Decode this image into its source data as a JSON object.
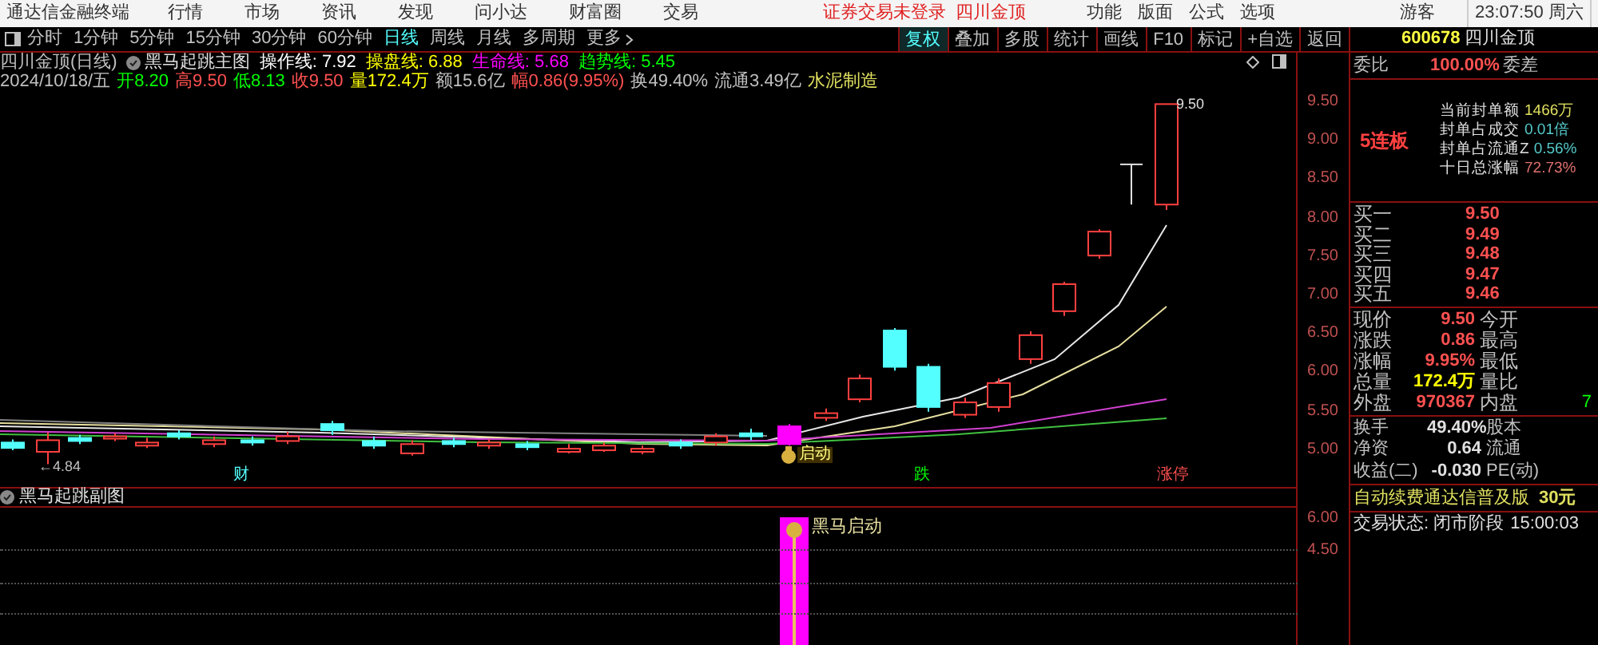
{
  "title_bar": {
    "app_name": "通达信金融终端",
    "menu": [
      "行情",
      "市场",
      "资讯",
      "发现",
      "问小达",
      "财富圈",
      "交易"
    ],
    "login_status": "证券交易未登录",
    "stock": "四川金顶",
    "tools": [
      "功能",
      "版面",
      "公式",
      "选项"
    ],
    "user": "游客",
    "clock": "23:07:50 周六"
  },
  "periods": [
    {
      "label": "分时",
      "selected": false
    },
    {
      "label": "1分钟",
      "selected": false
    },
    {
      "label": "5分钟",
      "selected": false
    },
    {
      "label": "15分钟",
      "selected": false
    },
    {
      "label": "30分钟",
      "selected": false
    },
    {
      "label": "60分钟",
      "selected": false
    },
    {
      "label": "日线",
      "selected": true
    },
    {
      "label": "周线",
      "selected": false
    },
    {
      "label": "月线",
      "selected": false
    },
    {
      "label": "多周期",
      "selected": false
    }
  ],
  "more": "更多",
  "toolbar": [
    {
      "label": "复权",
      "selected": true
    },
    {
      "label": "叠加",
      "selected": false
    },
    {
      "label": "多股",
      "selected": false
    },
    {
      "label": "统计",
      "selected": false
    },
    {
      "label": "画线",
      "selected": false
    },
    {
      "label": "F10",
      "selected": false
    },
    {
      "label": "标记",
      "selected": false
    },
    {
      "label": "+自选",
      "selected": false
    },
    {
      "label": "返回",
      "selected": false
    }
  ],
  "quote_header": {
    "code": "600678",
    "name": "四川金顶"
  },
  "indicator": {
    "title": "四川金顶(日线)",
    "name": "黑马起跳主图",
    "lines": [
      {
        "label": "操作线:",
        "value": "7.92",
        "color": "#ffffff"
      },
      {
        "label": "操盘线:",
        "value": "6.88",
        "color": "#ffff00"
      },
      {
        "label": "生命线:",
        "value": "5.68",
        "color": "#ff00ff"
      },
      {
        "label": "趋势线:",
        "value": "5.45",
        "color": "#00ff00"
      }
    ]
  },
  "day_stats": [
    {
      "text": "2024/10/18/五",
      "color": "#c0c0c0"
    },
    {
      "text": "开8.20",
      "color": "#00ff00"
    },
    {
      "text": "高9.50",
      "color": "#ff5050"
    },
    {
      "text": "低8.13",
      "color": "#00ff00"
    },
    {
      "text": "收9.50",
      "color": "#ff5050"
    },
    {
      "text": "量172.4万",
      "color": "#ffff00"
    },
    {
      "text": "额15.6亿",
      "color": "#c0c0c0"
    },
    {
      "text": "幅0.86(9.95%)",
      "color": "#ff5050"
    },
    {
      "text": "换49.40%",
      "color": "#c0c0c0"
    },
    {
      "text": "流通3.49亿",
      "color": "#c0c0c0"
    },
    {
      "text": "水泥制造",
      "color": "#e0e060"
    }
  ],
  "chart": {
    "price_ticks": [
      "9.50",
      "9.00",
      "8.50",
      "8.00",
      "7.50",
      "7.00",
      "6.50",
      "6.00",
      "5.50",
      "5.00"
    ],
    "high_label": "9.50",
    "low_label": "←4.84",
    "launch_tag": "启动",
    "signals": [
      {
        "text": "财",
        "color": "#54ffff"
      },
      {
        "text": "跌",
        "color": "#00ff00"
      },
      {
        "text": "涨停",
        "color": "#ff5050"
      }
    ]
  },
  "sub_chart": {
    "title": "黑马起跳副图",
    "ticks": [
      "6.00",
      "4.50"
    ],
    "signal": "黑马启动"
  },
  "quote_panel": {
    "ratio": {
      "label": "委比",
      "value": "100.00%",
      "label2": "委差"
    },
    "streak": "5连板",
    "seal_stats": [
      {
        "label": "当前封单额",
        "value": "1466万",
        "color": "#e0e060"
      },
      {
        "label": "封单占成交",
        "value": "0.01倍",
        "color": "#54c8c8"
      },
      {
        "label": "封单占流通Z",
        "value": "0.56%",
        "color": "#54c8c8"
      },
      {
        "label": "十日总涨幅",
        "value": "72.73%",
        "color": "#e07070"
      }
    ],
    "bids": [
      {
        "label": "买一",
        "price": "9.50"
      },
      {
        "label": "买二",
        "price": "9.49"
      },
      {
        "label": "买三",
        "price": "9.48"
      },
      {
        "label": "买四",
        "price": "9.47"
      },
      {
        "label": "买五",
        "price": "9.46"
      }
    ],
    "quotes": [
      {
        "label": "现价",
        "value": "9.50",
        "color": "#ff5050",
        "label2": "今开"
      },
      {
        "label": "涨跌",
        "value": "0.86",
        "color": "#ff5050",
        "label2": "最高"
      },
      {
        "label": "涨幅",
        "value": "9.95%",
        "color": "#ff5050",
        "label2": "最低"
      },
      {
        "label": "总量",
        "value": "172.4万",
        "color": "#ffff00",
        "label2": "量比"
      },
      {
        "label": "外盘",
        "value": "970367",
        "color": "#ff5050",
        "label2": "内盘",
        "value2": {
          "text": "7",
          "color": "#00ff00"
        }
      }
    ],
    "fundamentals": [
      {
        "label": "换手",
        "value": "49.40%",
        "label2": "股本"
      },
      {
        "label": "净资",
        "value": "0.64",
        "label2": "流通"
      },
      {
        "label": "收益(二)",
        "value": "-0.030",
        "label2": "PE(动)"
      }
    ],
    "notice": {
      "text": "自动续费通达信普及版",
      "price": "30元"
    },
    "status": {
      "text": "交易状态: 闭市阶段",
      "time": "15:00:03"
    }
  }
}
